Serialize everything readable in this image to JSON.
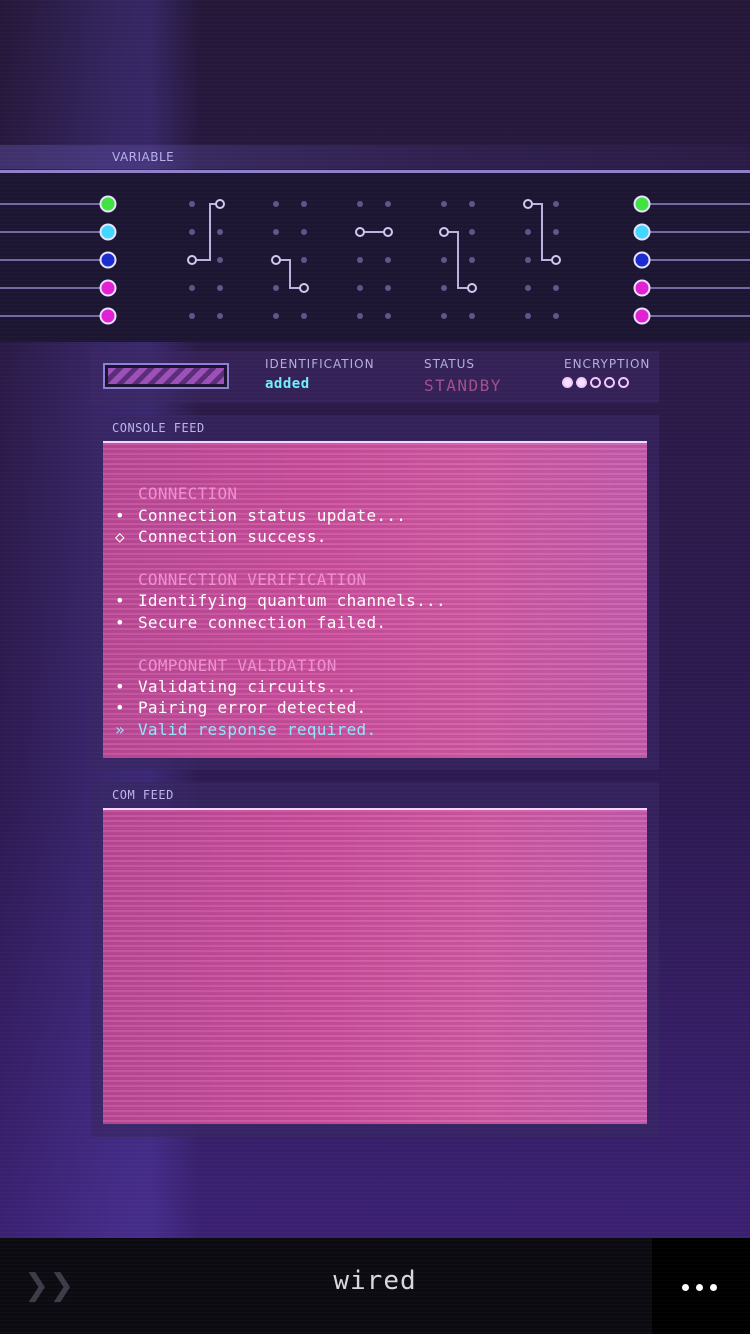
{
  "variable_panel": {
    "label": "VARIABLE",
    "left_nodes": [
      "#3fe23f",
      "#40d6ff",
      "#1a2ccf",
      "#e21fd2",
      "#e21fd2"
    ],
    "right_nodes": [
      "#3fe23f",
      "#40d6ff",
      "#1a2ccf",
      "#e21fd2",
      "#e21fd2"
    ]
  },
  "status": {
    "progress": 1.0,
    "identification_label": "IDENTIFICATION",
    "identification_value": "added",
    "status_label": "STATUS",
    "status_value": "STANDBY",
    "encryption_label": "ENCRYPTION",
    "encryption_level": 2,
    "encryption_total": 5
  },
  "console_feed": {
    "label": "CONSOLE FEED",
    "lines": [
      {
        "type": "gap",
        "text": ""
      },
      {
        "type": "header",
        "text": "CONNECTION"
      },
      {
        "type": "item",
        "bullet": "•",
        "text": "Connection status update..."
      },
      {
        "type": "item",
        "bullet": "◇",
        "text": "Connection success."
      },
      {
        "type": "gap",
        "text": ""
      },
      {
        "type": "header",
        "text": "CONNECTION VERIFICATION"
      },
      {
        "type": "item",
        "bullet": "•",
        "text": "Identifying quantum channels..."
      },
      {
        "type": "item",
        "bullet": "•",
        "text": "Secure connection failed."
      },
      {
        "type": "gap",
        "text": ""
      },
      {
        "type": "header",
        "text": "COMPONENT VALIDATION"
      },
      {
        "type": "item",
        "bullet": "•",
        "text": "Validating circuits..."
      },
      {
        "type": "item",
        "bullet": "•",
        "text": "Pairing error detected."
      },
      {
        "type": "accent",
        "bullet": "»",
        "text": "Valid response required."
      }
    ]
  },
  "com_feed": {
    "label": "COM FEED"
  },
  "bottom_bar": {
    "back_icon": "double-chevron-right-icon",
    "back_glyph": "❯❯",
    "title": "wired",
    "more_icon": "more-dots-icon"
  },
  "colors": {
    "accent_cyan": "#6ff0ff",
    "status_pink": "#a54d8e",
    "screen_pink": "#cf4f9f"
  }
}
